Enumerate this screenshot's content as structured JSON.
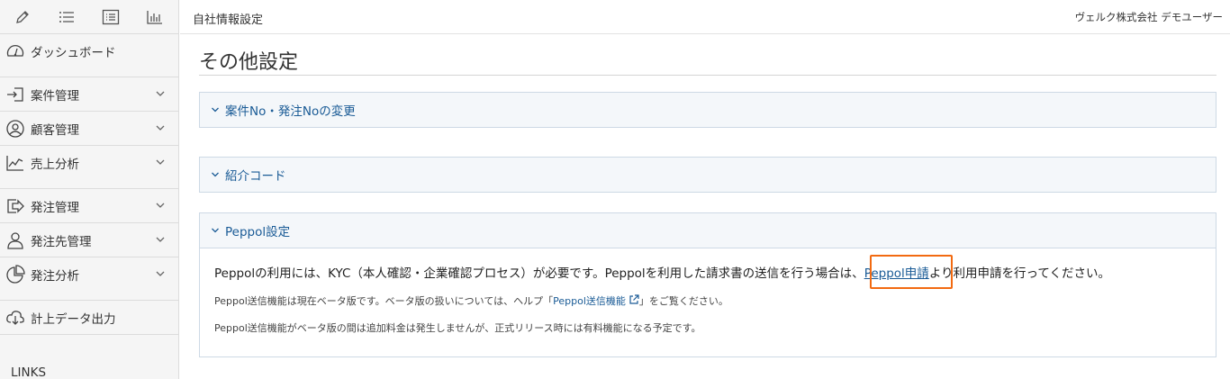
{
  "sidebar": {
    "toolbar_icons": [
      "pencil-icon",
      "list-icon",
      "checklist-icon",
      "bar-chart-icon"
    ],
    "items": [
      {
        "label": "ダッシュボード",
        "icon": "dashboard-icon"
      },
      {
        "label": "案件管理",
        "icon": "sign-in-icon"
      },
      {
        "label": "顧客管理",
        "icon": "user-circle-icon"
      },
      {
        "label": "売上分析",
        "icon": "trend-icon"
      },
      {
        "label": "発注管理",
        "icon": "sign-out-icon"
      },
      {
        "label": "発注先管理",
        "icon": "person-icon"
      },
      {
        "label": "発注分析",
        "icon": "pie-chart-icon"
      },
      {
        "label": "計上データ出力",
        "icon": "download-icon"
      }
    ],
    "links_label": "LINKS"
  },
  "topbar": {
    "title": "自社情報設定",
    "user": "ヴェルク株式会社 デモユーザー"
  },
  "main": {
    "title": "その他設定",
    "panels": [
      {
        "title": "案件No・発注Noの変更"
      },
      {
        "title": "紹介コード"
      },
      {
        "title": "Peppol設定",
        "body_before": "Peppolの利用には、KYC（本人確認・企業確認プロセス）が必要です。Peppolを利用した請求書の送信を行う場合は、",
        "link_label": "Peppol申請",
        "body_after": "より利用申請を行ってください。",
        "note1_before": "Peppol送信機能は現在ベータ版です。ベータ版の扱いについては、ヘルプ「",
        "note1_link": "Peppol送信機能",
        "note1_after": "」をご覧ください。",
        "note2": "Peppol送信機能がベータ版の間は追加料金は発生しませんが、正式リリース時には有料機能になる予定です。"
      }
    ]
  },
  "colors": {
    "accent": "#1a5b96",
    "highlight": "#f26a11",
    "panel_header": "#f4f7fa"
  }
}
